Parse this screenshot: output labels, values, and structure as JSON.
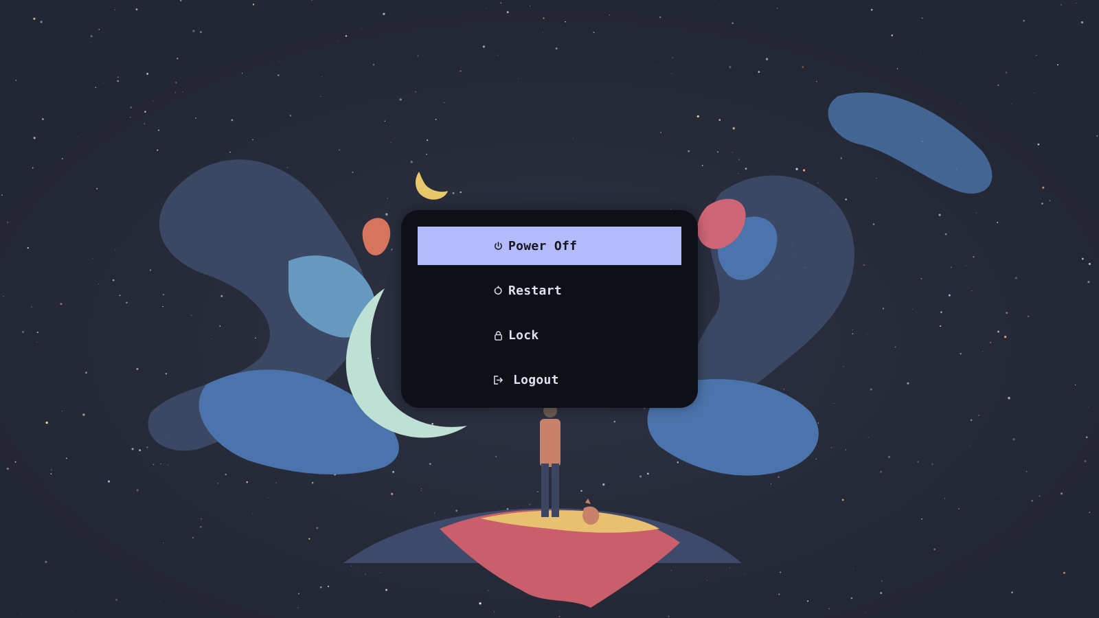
{
  "colors": {
    "background": "#252834",
    "menu_background": "#0f0f17",
    "selected_background": "#b4bbfb",
    "selected_text": "#14151f",
    "text": "#dfe1ee"
  },
  "menu": {
    "items": [
      {
        "label": "Power Off",
        "icon": "power-icon",
        "selected": true
      },
      {
        "label": "Restart",
        "icon": "restart-icon",
        "selected": false
      },
      {
        "label": "Lock",
        "icon": "lock-icon",
        "selected": false
      },
      {
        "label": "Logout",
        "icon": "logout-icon",
        "selected": false
      }
    ]
  }
}
